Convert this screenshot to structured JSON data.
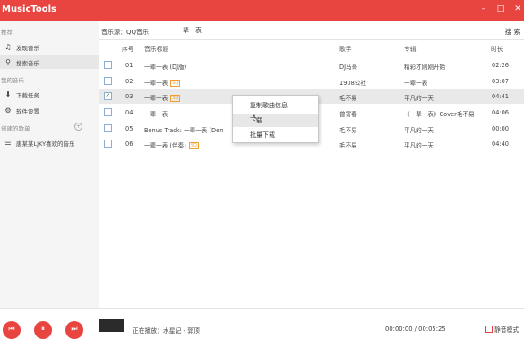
{
  "window": {
    "title": "MusicTools",
    "controls": {
      "minimize": "–",
      "maximize": "□",
      "close": "✕"
    }
  },
  "sidebar": {
    "group_recommend": "推荐",
    "discover": "发现音乐",
    "search": "搜索音乐",
    "group_my_music": "我的音乐",
    "downloads": "下载任务",
    "settings": "软件设置",
    "group_playlists": "创建的歌单",
    "playlist_1": "唐某某LJKY喜欢的音乐"
  },
  "topbar": {
    "source_label": "音乐源：QQ音乐",
    "search_value": "一辈一表",
    "search_button": "搜 索"
  },
  "table": {
    "headers": {
      "index": "序号",
      "title": "音乐标题",
      "artist": "歌手",
      "album": "专辑",
      "duration": "时长"
    },
    "rows": [
      {
        "index": "01",
        "title": "一辈一表 (DJ版)",
        "sq": "",
        "artist": "DJ马哥",
        "album": "精彩才刚刚开始",
        "duration": "02:26",
        "checked": false
      },
      {
        "index": "02",
        "title": "一辈一表",
        "sq": "SQ",
        "artist": "1908公社",
        "album": "一辈一表",
        "duration": "03:07",
        "checked": false
      },
      {
        "index": "03",
        "title": "一辈一表",
        "sq": "SQ",
        "artist": "毛不易",
        "album": "平凡的一天",
        "duration": "04:41",
        "checked": true
      },
      {
        "index": "04",
        "title": "一辈一表",
        "sq": "",
        "artist": "曾寄春",
        "album": "《一辈一表》Cover毛不易",
        "duration": "04:06",
        "checked": false
      },
      {
        "index": "05",
        "title": "Bonus Track: 一辈一表 (Den",
        "sq": "",
        "artist": "毛不易",
        "album": "平凡的一天",
        "duration": "00:00",
        "checked": false
      },
      {
        "index": "06",
        "title": "一辈一表 (伴奏)",
        "sq": "SQ",
        "artist": "毛不易",
        "album": "平凡的一天",
        "duration": "04:40",
        "checked": false
      }
    ]
  },
  "context_menu": {
    "copy_info": "复制歌曲信息",
    "download": "下载",
    "batch_download": "批量下载"
  },
  "player": {
    "now_playing": "正在播放：水星记 - 郭顶",
    "time": "00:00:00 / 00:05:25",
    "mute_label": "静音模式",
    "prev": "⏮",
    "pause": "⏸",
    "next": "⏭"
  },
  "colors": {
    "accent": "#e84541"
  }
}
